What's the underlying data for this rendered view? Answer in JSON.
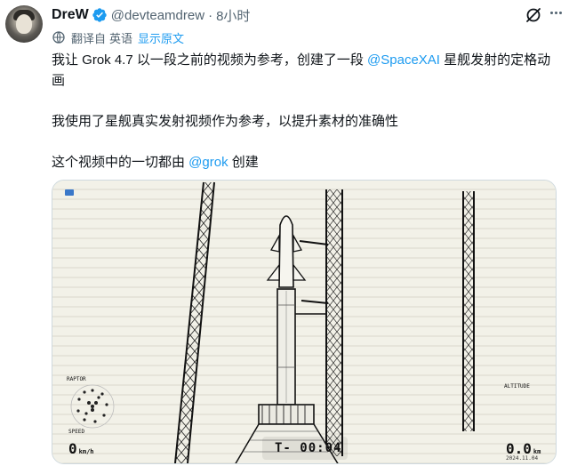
{
  "author": {
    "name": "DreW",
    "handle": "@devteamdrew",
    "separator": "·",
    "time": "8小时"
  },
  "translation": {
    "label": "翻译自",
    "language": "英语",
    "show_original": "显示原文"
  },
  "tweet": {
    "p1_before": "我让 Grok 4.7 以一段之前的视频为参考，创建了一段 ",
    "p1_mention": "@SpaceXAI",
    "p1_after": " 星舰发射的定格动画",
    "p2": "我使用了星舰真实发射视频作为参考，以提升素材的准确性",
    "p3_before": "这个视频中的一切都由 ",
    "p3_mention": "@grok",
    "p3_after": " 创建"
  },
  "video": {
    "timer": "T- 00:04",
    "speed_value": "0",
    "speed_unit": "km/h",
    "altitude_value": "0.0",
    "altitude_unit": "km",
    "raptor_label": "RAPTOR",
    "speed_label": "SPEED",
    "altitude_label": "ALTITUDE",
    "stamp": "2024.11.04"
  },
  "colors": {
    "accent": "#1d9bf0",
    "text_primary": "#0f1419",
    "text_secondary": "#536471",
    "paper": "#f2f1e8"
  },
  "icons": {
    "verified": "verified-badge-icon",
    "grok": "grok-icon",
    "more": "more-icon",
    "translate": "translate-icon"
  }
}
